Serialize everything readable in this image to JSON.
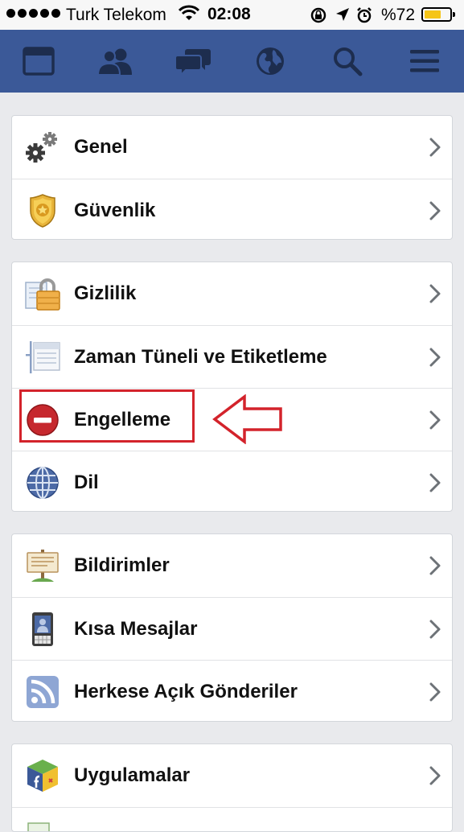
{
  "status_bar": {
    "carrier": "Turk Telekom",
    "time": "02:08",
    "battery_text": "%72",
    "battery_level": 0.72,
    "signal_bars": 5,
    "icons": [
      "wifi-icon",
      "rotation-lock-icon",
      "location-icon",
      "alarm-icon",
      "battery-icon"
    ]
  },
  "navbar": {
    "items": [
      "news-feed-icon",
      "friends-icon",
      "messages-icon",
      "notifications-globe-icon",
      "search-icon",
      "menu-icon"
    ]
  },
  "settings": {
    "groups": [
      {
        "items": [
          {
            "label": "Genel",
            "icon": "gears-icon"
          },
          {
            "label": "Güvenlik",
            "icon": "security-badge-icon"
          }
        ]
      },
      {
        "items": [
          {
            "label": "Gizlilik",
            "icon": "privacy-lock-icon"
          },
          {
            "label": "Zaman Tüneli ve Etiketleme",
            "icon": "timeline-icon"
          },
          {
            "label": "Engelleme",
            "icon": "blocking-icon"
          },
          {
            "label": "Dil",
            "icon": "globe-icon"
          }
        ]
      },
      {
        "items": [
          {
            "label": "Bildirimler",
            "icon": "notification-sign-icon"
          },
          {
            "label": "Kısa Mesajlar",
            "icon": "phone-icon"
          },
          {
            "label": "Herkese Açık Gönderiler",
            "icon": "rss-icon"
          }
        ]
      },
      {
        "items": [
          {
            "label": "Uygulamalar",
            "icon": "apps-cube-icon"
          }
        ]
      }
    ]
  },
  "colors": {
    "navbar": "#3b5998",
    "background": "#e9eaed",
    "annotation": "#d3232b",
    "battery": "#f5c518"
  }
}
